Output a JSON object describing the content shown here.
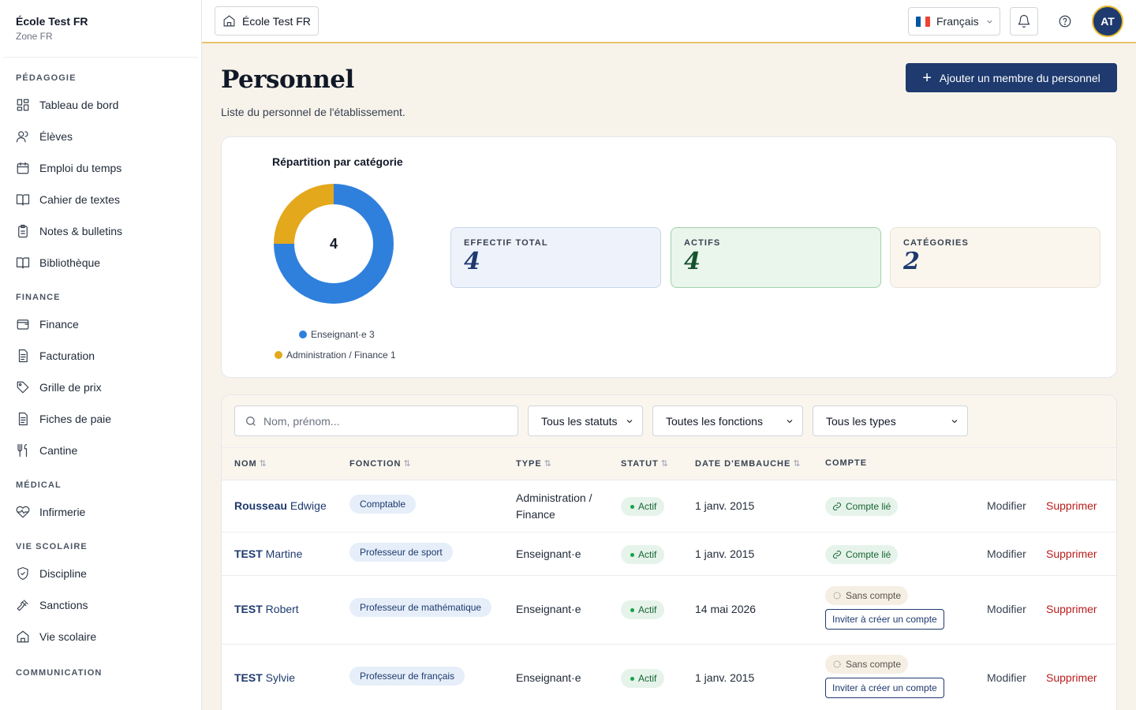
{
  "school": {
    "name": "École Test FR",
    "zone": "Zone FR"
  },
  "sidebar": {
    "sections": [
      {
        "title": "Pédagogie",
        "items": [
          {
            "label": "Tableau de bord",
            "icon": "dashboard-icon"
          },
          {
            "label": "Élèves",
            "icon": "users-icon"
          },
          {
            "label": "Emploi du temps",
            "icon": "calendar-icon"
          },
          {
            "label": "Cahier de textes",
            "icon": "book-open-icon"
          },
          {
            "label": "Notes & bulletins",
            "icon": "clipboard-icon"
          },
          {
            "label": "Bibliothèque",
            "icon": "library-icon"
          }
        ]
      },
      {
        "title": "Finance",
        "items": [
          {
            "label": "Finance",
            "icon": "wallet-icon"
          },
          {
            "label": "Facturation",
            "icon": "invoice-icon"
          },
          {
            "label": "Grille de prix",
            "icon": "tag-icon"
          },
          {
            "label": "Fiches de paie",
            "icon": "payslip-icon"
          },
          {
            "label": "Cantine",
            "icon": "utensils-icon"
          }
        ]
      },
      {
        "title": "Médical",
        "items": [
          {
            "label": "Infirmerie",
            "icon": "heart-pulse-icon"
          }
        ]
      },
      {
        "title": "Vie scolaire",
        "items": [
          {
            "label": "Discipline",
            "icon": "shield-icon"
          },
          {
            "label": "Sanctions",
            "icon": "gavel-icon"
          },
          {
            "label": "Vie scolaire",
            "icon": "school-icon"
          }
        ]
      },
      {
        "title": "Communication",
        "items": []
      }
    ]
  },
  "topbar": {
    "school_label": "École Test FR",
    "language": "Français",
    "avatar_initials": "AT"
  },
  "page": {
    "title": "Personnel",
    "subtitle": "Liste du personnel de l'établissement.",
    "add_button": "Ajouter un membre du personnel"
  },
  "stats": {
    "chart_title": "Répartition par catégorie",
    "total_center": "4",
    "kpis": [
      {
        "label": "Effectif total",
        "value": "4",
        "bg": "#eef3fb",
        "border": "#c7d4ea",
        "color": "#1e3a6e"
      },
      {
        "label": "Actifs",
        "value": "4",
        "bg": "#eaf5ec",
        "border": "#9fd3a9",
        "color": "#14532d"
      },
      {
        "label": "Catégories",
        "value": "2",
        "bg": "#faf6ee",
        "border": "#ebe5d6",
        "color": "#1e3a6e"
      }
    ]
  },
  "chart_data": {
    "type": "pie",
    "title": "Répartition par catégorie",
    "categories": [
      "Enseignant·e",
      "Administration / Finance"
    ],
    "values": [
      3,
      1
    ],
    "colors": [
      "#2f80dc",
      "#e3a81b"
    ],
    "legend_labels": [
      "Enseignant·e 3",
      "Administration / Finance 1"
    ]
  },
  "filters": {
    "search_placeholder": "Nom, prénom...",
    "status": "Tous les statuts",
    "function": "Toutes les fonctions",
    "type": "Tous les types"
  },
  "table": {
    "columns": [
      "Nom",
      "Fonction",
      "Type",
      "Statut",
      "Date d'embauche",
      "Compte"
    ],
    "rows": [
      {
        "last": "Rousseau",
        "first": "Edwige",
        "function": "Comptable",
        "type": "Administration / Finance",
        "status": "Actif",
        "hire_date": "1 janv. 2015",
        "account": "Compte lié",
        "invite": ""
      },
      {
        "last": "TEST",
        "first": "Martine",
        "function": "Professeur de sport",
        "type": "Enseignant·e",
        "status": "Actif",
        "hire_date": "1 janv. 2015",
        "account": "Compte lié",
        "invite": ""
      },
      {
        "last": "TEST",
        "first": "Robert",
        "function": "Professeur de mathématique",
        "type": "Enseignant·e",
        "status": "Actif",
        "hire_date": "14 mai 2026",
        "account": "Sans compte",
        "invite": "Inviter à créer un compte"
      },
      {
        "last": "TEST",
        "first": "Sylvie",
        "function": "Professeur de français",
        "type": "Enseignant·e",
        "status": "Actif",
        "hire_date": "1 janv. 2015",
        "account": "Sans compte",
        "invite": "Inviter à créer un compte"
      }
    ],
    "edit_label": "Modifier",
    "delete_label": "Supprimer"
  }
}
